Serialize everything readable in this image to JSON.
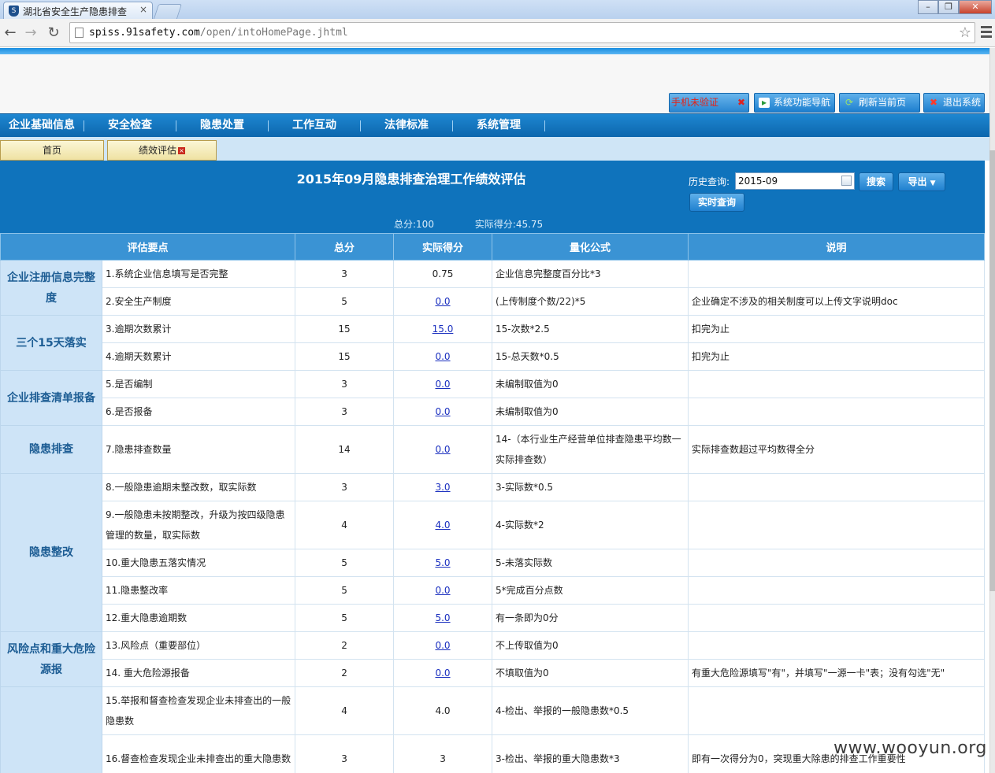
{
  "browser": {
    "tab_title": "湖北省安全生产隐患排查",
    "favicon_glyph": "S",
    "url_host": "spiss.91safety.com",
    "url_path": "/open/intoHomePage.jhtml"
  },
  "toolbar": {
    "alert_label": "手机未验证",
    "nav_guide_label": "系统功能导航",
    "refresh_label": "刷新当前页",
    "logout_label": "退出系统"
  },
  "main_nav": [
    "企业基础信息",
    "安全检查",
    "隐患处置",
    "工作互动",
    "法律标准",
    "系统管理"
  ],
  "page_tabs": {
    "home": "首页",
    "perf": "绩效评估"
  },
  "panel": {
    "title": "2015年09月隐患排查治理工作绩效评估",
    "history_label": "历史查询:",
    "history_value": "2015-09",
    "search_label": "搜索",
    "export_label": "导出",
    "realtime_label": "实时查询",
    "total_score": "总分:100",
    "actual_score": "实际得分:45.75"
  },
  "table": {
    "headers": [
      "评估要点",
      "总分",
      "实际得分",
      "量化公式",
      "说明"
    ],
    "categories": [
      "企业注册信息完整度",
      "三个15天落实",
      "企业排查清单报备",
      "隐患排查",
      "隐患整改",
      "风险点和重大危险源报",
      ""
    ],
    "rows": [
      {
        "point": "1.系统企业信息填写是否完整",
        "total": "3",
        "actual": "0.75",
        "formula": "企业信息完整度百分比*3",
        "note": ""
      },
      {
        "point": "2.安全生产制度",
        "total": "5",
        "actual": "0.0",
        "formula": "(上传制度个数/22)*5",
        "note": "企业确定不涉及的相关制度可以上传文字说明doc"
      },
      {
        "point": "3.逾期次数累计",
        "total": "15",
        "actual": "15.0",
        "formula": "15-次数*2.5",
        "note": "扣完为止"
      },
      {
        "point": "4.逾期天数累计",
        "total": "15",
        "actual": "0.0",
        "formula": "15-总天数*0.5",
        "note": "扣完为止"
      },
      {
        "point": "5.是否编制",
        "total": "3",
        "actual": "0.0",
        "formula": "未编制取值为0",
        "note": ""
      },
      {
        "point": "6.是否报备",
        "total": "3",
        "actual": "0.0",
        "formula": "未编制取值为0",
        "note": ""
      },
      {
        "point": "7.隐患排查数量",
        "total": "14",
        "actual": "0.0",
        "formula": "14-（本行业生产经营单位排查隐患平均数一实际排查数）",
        "note": "实际排查数超过平均数得全分"
      },
      {
        "point": "8.一般隐患逾期未整改数，取实际数",
        "total": "3",
        "actual": "3.0",
        "formula": "3-实际数*0.5",
        "note": ""
      },
      {
        "point": "9.一般隐患未按期整改，升级为按四级隐患管理的数量，取实际数",
        "total": "4",
        "actual": "4.0",
        "formula": "4-实际数*2",
        "note": ""
      },
      {
        "point": "10.重大隐患五落实情况",
        "total": "5",
        "actual": "5.0",
        "formula": "5-未落实际数",
        "note": ""
      },
      {
        "point": "11.隐患整改率",
        "total": "5",
        "actual": "0.0",
        "formula": "5*完成百分点数",
        "note": ""
      },
      {
        "point": "12.重大隐患逾期数",
        "total": "5",
        "actual": "5.0",
        "formula": "有一条即为0分",
        "note": ""
      },
      {
        "point": "13.风险点（重要部位）",
        "total": "2",
        "actual": "0.0",
        "formula": "不上传取值为0",
        "note": ""
      },
      {
        "point": "14. 重大危险源报备",
        "total": "2",
        "actual": "0.0",
        "formula": "不填取值为0",
        "note": "有重大危险源填写\"有\"，并填写\"一源一卡\"表；没有勾选\"无\""
      },
      {
        "point": "15.举报和督查检查发现企业未排查出的一般隐患数",
        "total": "4",
        "actual": "4.0",
        "formula": "4-检出、举报的一般隐患数*0.5",
        "note": ""
      },
      {
        "point": "16.督查检查发现企业未排查出的重大隐患数",
        "total": "3",
        "actual": "3",
        "formula": "3-检出、举报的重大隐患数*3",
        "note": "即有一次得分为0，突现重大除患的排查工作重要性"
      }
    ]
  },
  "watermark": "www.wooyun.org"
}
